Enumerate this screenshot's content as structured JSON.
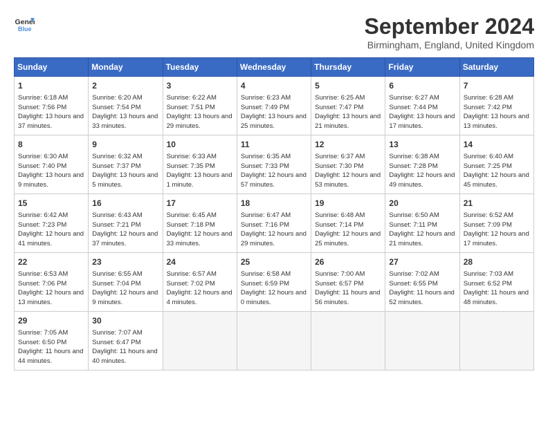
{
  "logo": {
    "line1": "General",
    "line2": "Blue"
  },
  "title": "September 2024",
  "location": "Birmingham, England, United Kingdom",
  "days_of_week": [
    "Sunday",
    "Monday",
    "Tuesday",
    "Wednesday",
    "Thursday",
    "Friday",
    "Saturday"
  ],
  "weeks": [
    [
      {
        "day": "1",
        "sunrise": "6:18 AM",
        "sunset": "7:56 PM",
        "daylight": "13 hours and 37 minutes."
      },
      {
        "day": "2",
        "sunrise": "6:20 AM",
        "sunset": "7:54 PM",
        "daylight": "13 hours and 33 minutes."
      },
      {
        "day": "3",
        "sunrise": "6:22 AM",
        "sunset": "7:51 PM",
        "daylight": "13 hours and 29 minutes."
      },
      {
        "day": "4",
        "sunrise": "6:23 AM",
        "sunset": "7:49 PM",
        "daylight": "13 hours and 25 minutes."
      },
      {
        "day": "5",
        "sunrise": "6:25 AM",
        "sunset": "7:47 PM",
        "daylight": "13 hours and 21 minutes."
      },
      {
        "day": "6",
        "sunrise": "6:27 AM",
        "sunset": "7:44 PM",
        "daylight": "13 hours and 17 minutes."
      },
      {
        "day": "7",
        "sunrise": "6:28 AM",
        "sunset": "7:42 PM",
        "daylight": "13 hours and 13 minutes."
      }
    ],
    [
      {
        "day": "8",
        "sunrise": "6:30 AM",
        "sunset": "7:40 PM",
        "daylight": "13 hours and 9 minutes."
      },
      {
        "day": "9",
        "sunrise": "6:32 AM",
        "sunset": "7:37 PM",
        "daylight": "13 hours and 5 minutes."
      },
      {
        "day": "10",
        "sunrise": "6:33 AM",
        "sunset": "7:35 PM",
        "daylight": "13 hours and 1 minute."
      },
      {
        "day": "11",
        "sunrise": "6:35 AM",
        "sunset": "7:33 PM",
        "daylight": "12 hours and 57 minutes."
      },
      {
        "day": "12",
        "sunrise": "6:37 AM",
        "sunset": "7:30 PM",
        "daylight": "12 hours and 53 minutes."
      },
      {
        "day": "13",
        "sunrise": "6:38 AM",
        "sunset": "7:28 PM",
        "daylight": "12 hours and 49 minutes."
      },
      {
        "day": "14",
        "sunrise": "6:40 AM",
        "sunset": "7:25 PM",
        "daylight": "12 hours and 45 minutes."
      }
    ],
    [
      {
        "day": "15",
        "sunrise": "6:42 AM",
        "sunset": "7:23 PM",
        "daylight": "12 hours and 41 minutes."
      },
      {
        "day": "16",
        "sunrise": "6:43 AM",
        "sunset": "7:21 PM",
        "daylight": "12 hours and 37 minutes."
      },
      {
        "day": "17",
        "sunrise": "6:45 AM",
        "sunset": "7:18 PM",
        "daylight": "12 hours and 33 minutes."
      },
      {
        "day": "18",
        "sunrise": "6:47 AM",
        "sunset": "7:16 PM",
        "daylight": "12 hours and 29 minutes."
      },
      {
        "day": "19",
        "sunrise": "6:48 AM",
        "sunset": "7:14 PM",
        "daylight": "12 hours and 25 minutes."
      },
      {
        "day": "20",
        "sunrise": "6:50 AM",
        "sunset": "7:11 PM",
        "daylight": "12 hours and 21 minutes."
      },
      {
        "day": "21",
        "sunrise": "6:52 AM",
        "sunset": "7:09 PM",
        "daylight": "12 hours and 17 minutes."
      }
    ],
    [
      {
        "day": "22",
        "sunrise": "6:53 AM",
        "sunset": "7:06 PM",
        "daylight": "12 hours and 13 minutes."
      },
      {
        "day": "23",
        "sunrise": "6:55 AM",
        "sunset": "7:04 PM",
        "daylight": "12 hours and 9 minutes."
      },
      {
        "day": "24",
        "sunrise": "6:57 AM",
        "sunset": "7:02 PM",
        "daylight": "12 hours and 4 minutes."
      },
      {
        "day": "25",
        "sunrise": "6:58 AM",
        "sunset": "6:59 PM",
        "daylight": "12 hours and 0 minutes."
      },
      {
        "day": "26",
        "sunrise": "7:00 AM",
        "sunset": "6:57 PM",
        "daylight": "11 hours and 56 minutes."
      },
      {
        "day": "27",
        "sunrise": "7:02 AM",
        "sunset": "6:55 PM",
        "daylight": "11 hours and 52 minutes."
      },
      {
        "day": "28",
        "sunrise": "7:03 AM",
        "sunset": "6:52 PM",
        "daylight": "11 hours and 48 minutes."
      }
    ],
    [
      {
        "day": "29",
        "sunrise": "7:05 AM",
        "sunset": "6:50 PM",
        "daylight": "11 hours and 44 minutes."
      },
      {
        "day": "30",
        "sunrise": "7:07 AM",
        "sunset": "6:47 PM",
        "daylight": "11 hours and 40 minutes."
      },
      null,
      null,
      null,
      null,
      null
    ]
  ]
}
